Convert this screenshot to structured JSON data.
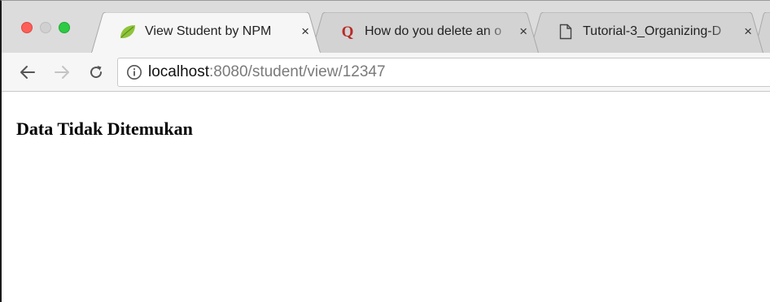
{
  "window": {
    "traffic_lights": [
      "close",
      "minimize",
      "zoom"
    ]
  },
  "tabs": [
    {
      "title": "View Student by NPM",
      "icon": "spring-leaf-icon",
      "active": true,
      "close": "×"
    },
    {
      "title": "How do you delete an o",
      "icon": "quora-q-icon",
      "active": false,
      "close": "×"
    },
    {
      "title": "Tutorial-3_Organizing-D",
      "icon": "document-icon",
      "active": false,
      "close": "×"
    }
  ],
  "toolbar": {
    "back_icon": "arrow-left-icon",
    "forward_icon": "arrow-right-icon",
    "reload_icon": "reload-icon",
    "url_host": "localhost",
    "url_rest": ":8080/student/view/12347"
  },
  "page": {
    "heading": "Data Tidak Ditemukan"
  },
  "colors": {
    "tab_strip": "#dcdcdc",
    "toolbar": "#f6f6f6",
    "close_light": "#fc5f57",
    "zoom_light": "#2ccb43",
    "spring_green": "#8fc43a",
    "quora_red": "#b92b27"
  }
}
